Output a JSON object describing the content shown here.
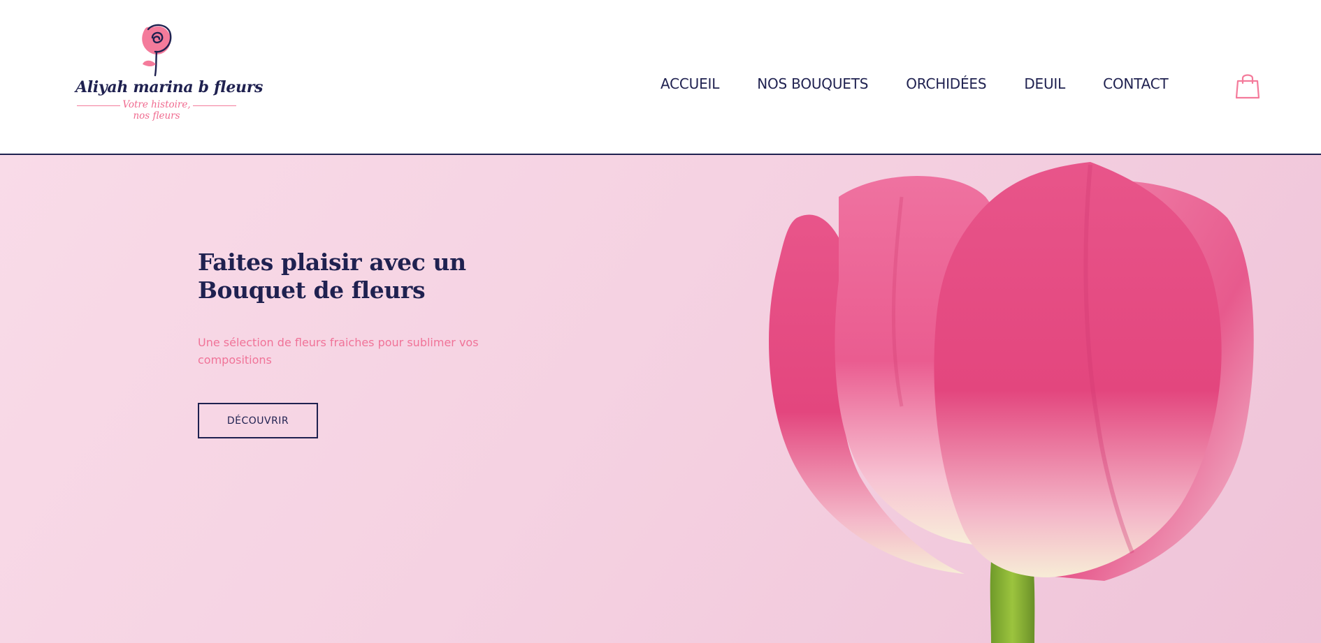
{
  "header": {
    "logo": {
      "name": "Aliyah marina b fleurs",
      "tagline_line1": "Votre histoire,",
      "tagline_line2": "nos fleurs"
    },
    "nav": [
      "ACCUEIL",
      "NOS BOUQUETS",
      "ORCHIDÉES",
      "DEUIL",
      "CONTACT"
    ],
    "cart_icon": "shopping-bag-icon"
  },
  "hero": {
    "title": "Faites plaisir avec un Bouquet de fleurs",
    "subtitle": "Une sélection de fleurs fraiches pour sublimer vos compositions",
    "cta_label": "DÉCOUVRIR",
    "image": "pink-tulip"
  },
  "colors": {
    "navy": "#1f2150",
    "pink_accent": "#f07398",
    "hero_bg": "#f5d2e2"
  }
}
